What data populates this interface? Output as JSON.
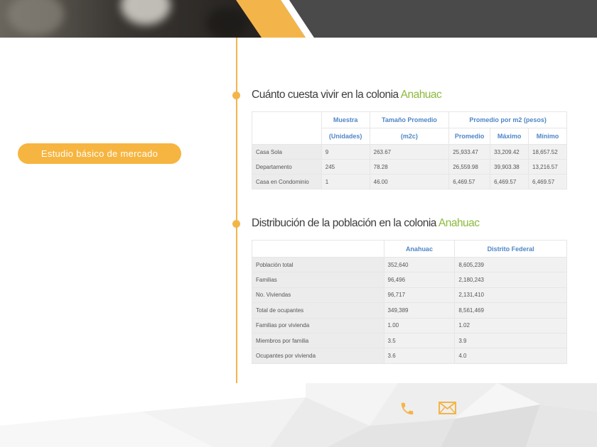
{
  "colors": {
    "accent": "#f3b54a",
    "highlight": "#8cba3d",
    "header_text": "#4f86c6"
  },
  "pill": {
    "label": "Estudio básico de mercado"
  },
  "section1": {
    "title_prefix": "Cuánto cuesta vivir en la colonia ",
    "title_highlight": "Anahuac",
    "headers": {
      "muestra_1": "Muestra",
      "muestra_2": "(Unidades)",
      "tamano_1": "Tamaño Promedio",
      "tamano_2": "(m2c)",
      "promedio_m2": "Promedio por m2 (pesos)",
      "promedio": "Promedio",
      "maximo": "Máximo",
      "minimo": "Mínimo"
    },
    "rows": [
      [
        "Casa Sola",
        "9",
        "263.67",
        "25,933.47",
        "33,209.42",
        "18,657.52"
      ],
      [
        "Departamento",
        "245",
        "78.28",
        "26,559.98",
        "39,903.38",
        "13,216.57"
      ],
      [
        "Casa en Condominio",
        "1",
        "46.00",
        "6,469.57",
        "6,469.57",
        "6,469.57"
      ]
    ]
  },
  "section2": {
    "title_prefix": "Distribución de la población en la colonia ",
    "title_highlight": "Anahuac",
    "headers": {
      "col1": "Anahuac",
      "col2": "Distrito Federal"
    },
    "rows": [
      [
        "Población total",
        "352,640",
        "8,605,239"
      ],
      [
        "Familias",
        "96,496",
        "2,180,243"
      ],
      [
        "No. Viviendas",
        "96,717",
        "2,131,410"
      ],
      [
        "Total de ocupantes",
        "349,389",
        "8,561,469"
      ],
      [
        "Familias por vivienda",
        "1.00",
        "1.02"
      ],
      [
        "Miembros por familia",
        "3.5",
        "3.9"
      ],
      [
        "Ocupantes por vivienda",
        "3.6",
        "4.0"
      ]
    ]
  },
  "footer": {
    "icons": [
      "phone-icon",
      "mail-icon"
    ]
  }
}
